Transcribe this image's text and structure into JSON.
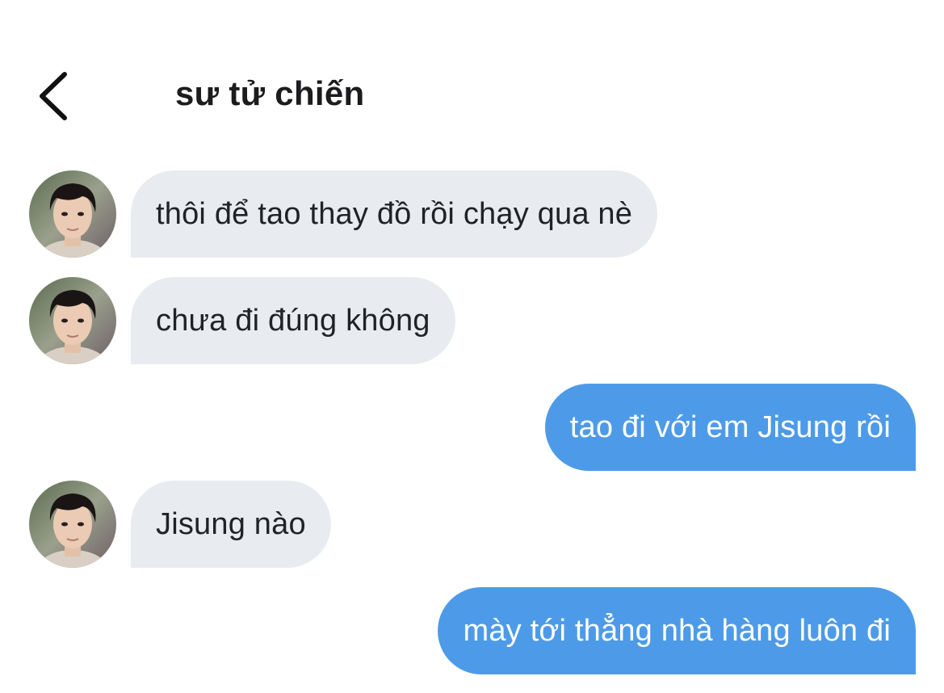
{
  "header": {
    "title": "sư tử chiến",
    "back_icon": "chevron-left-icon"
  },
  "colors": {
    "incoming_bubble": "#e8ecf0",
    "outgoing_bubble": "#4d9be8",
    "incoming_text": "#1f2326",
    "outgoing_text": "#ffffff"
  },
  "messages": [
    {
      "sender": "them",
      "text": "thôi để tao thay đồ rồi chạy qua nè"
    },
    {
      "sender": "them",
      "text": "chưa đi đúng không"
    },
    {
      "sender": "me",
      "text": "tao đi với em Jisung rồi"
    },
    {
      "sender": "them",
      "text": "Jisung nào"
    },
    {
      "sender": "me",
      "text": "mày tới thẳng nhà hàng luôn đi"
    }
  ]
}
